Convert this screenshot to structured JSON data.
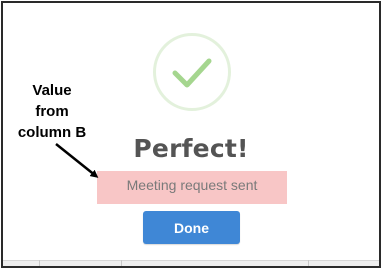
{
  "dialog": {
    "title": "Perfect!",
    "message": "Meeting request sent",
    "done_label": "Done"
  },
  "annotation": {
    "line1": "Value",
    "line2": "from",
    "line3": "column B"
  },
  "icons": {
    "success": "checkmark-icon"
  },
  "colors": {
    "success_ring": "#e3f1dc",
    "success_check": "#a5d68f",
    "title_text": "#545454",
    "message_text": "#7a7a7a",
    "highlight": "#f8c6c6",
    "button": "#3f87d6",
    "button_text": "#ffffff"
  }
}
